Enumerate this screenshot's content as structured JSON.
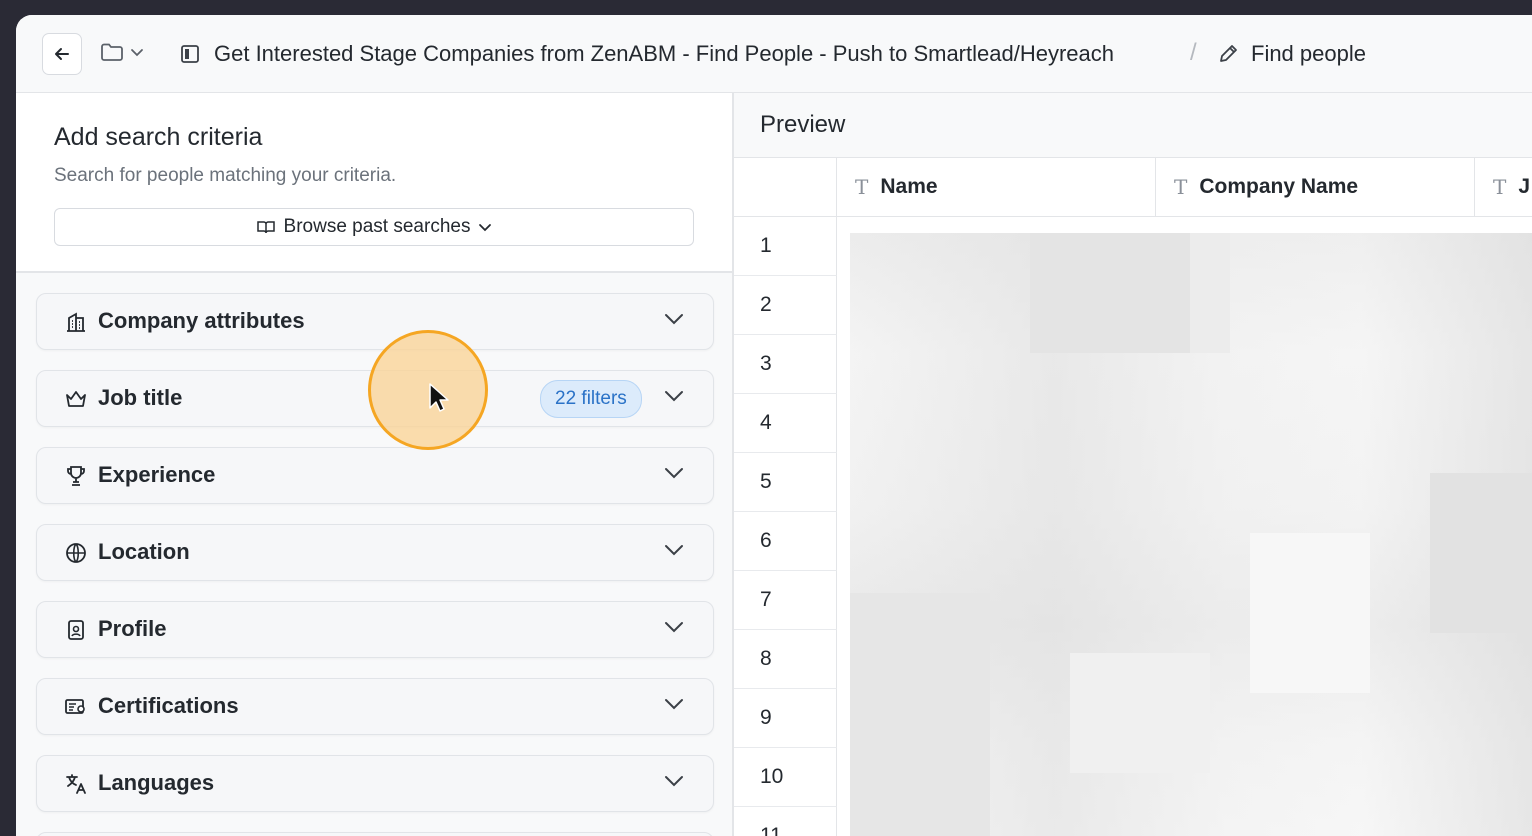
{
  "header": {
    "breadcrumb_title": "Get Interested Stage Companies from ZenABM - Find People - Push to Smartlead/Heyreach",
    "separator": "/",
    "current": "Find people"
  },
  "criteria": {
    "title": "Add search criteria",
    "subtitle": "Search for people matching your criteria.",
    "browse_label": "Browse past searches"
  },
  "sections": [
    {
      "label": "Company attributes",
      "icon": "building-icon"
    },
    {
      "label": "Job title",
      "icon": "crown-icon",
      "badge": "22 filters"
    },
    {
      "label": "Experience",
      "icon": "trophy-icon"
    },
    {
      "label": "Location",
      "icon": "globe-icon"
    },
    {
      "label": "Profile",
      "icon": "id-badge-icon"
    },
    {
      "label": "Certifications",
      "icon": "certificate-icon"
    },
    {
      "label": "Languages",
      "icon": "translate-icon"
    }
  ],
  "preview": {
    "title": "Preview",
    "columns": [
      {
        "type_glyph": "T",
        "name": "Name"
      },
      {
        "type_glyph": "T",
        "name": "Company Name"
      },
      {
        "type_glyph": "T",
        "name": "J"
      }
    ],
    "rows": [
      "1",
      "2",
      "3",
      "4",
      "5",
      "6",
      "7",
      "8",
      "9",
      "10",
      "11"
    ]
  },
  "colors": {
    "accent_badge_bg": "#dcebfb",
    "accent_badge_text": "#2a72c7",
    "cursor_highlight": "#f5a623"
  }
}
